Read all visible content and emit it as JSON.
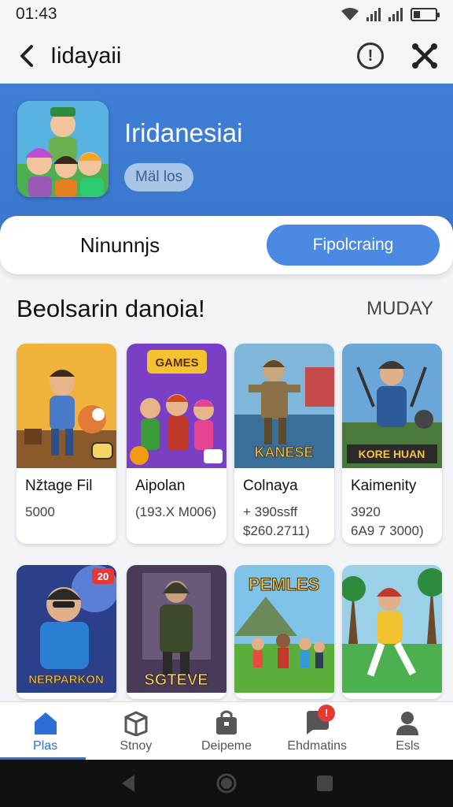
{
  "status_bar": {
    "time": "01:43"
  },
  "app_bar": {
    "title": "Iidayaii",
    "info_label": "!"
  },
  "hero": {
    "title": "Iridanesiai",
    "badge": "Mäl los"
  },
  "toggle": {
    "left_label": "Ninunnjs",
    "right_label": "Fipolcraing"
  },
  "section": {
    "title": "Beolsarin danoia!",
    "more": "MUDAY"
  },
  "games": [
    {
      "name": "Nžtage Fil",
      "meta": "5000",
      "art_text": "",
      "art": "a"
    },
    {
      "name": "Aipolan",
      "meta": "(193.X M006)",
      "art_text": "GAMES",
      "art": "b"
    },
    {
      "name": "Colnaya",
      "meta": "+ 390ssff\n$260.2711)",
      "art_text": "KANESE",
      "art": "c"
    },
    {
      "name": "Kaimenity",
      "meta": "3920\n6A9 7 3000)",
      "art_text": "KORE HUAN",
      "art": "d"
    },
    {
      "name": "",
      "meta": "",
      "art_text": "NERPARKON",
      "badge": "20",
      "art": "e"
    },
    {
      "name": "",
      "meta": "",
      "art_text": "SGTEVE",
      "art": "f"
    },
    {
      "name": "",
      "meta": "",
      "art_text": "PEMLES",
      "art": "g"
    },
    {
      "name": "",
      "meta": "",
      "art_text": "",
      "art": "h"
    }
  ],
  "bottom_nav": [
    {
      "label": "Plas",
      "icon": "home-icon",
      "active": true
    },
    {
      "label": "Stnoy",
      "icon": "box-icon"
    },
    {
      "label": "Deipeme",
      "icon": "bag-icon"
    },
    {
      "label": "Ehdmatins",
      "icon": "chat-icon",
      "badge": "!"
    },
    {
      "label": "Esls",
      "icon": "user-icon"
    }
  ],
  "colors": {
    "accent": "#2c6fd6",
    "hero": "#3f7fd6",
    "pill": "#4a8ae3"
  }
}
